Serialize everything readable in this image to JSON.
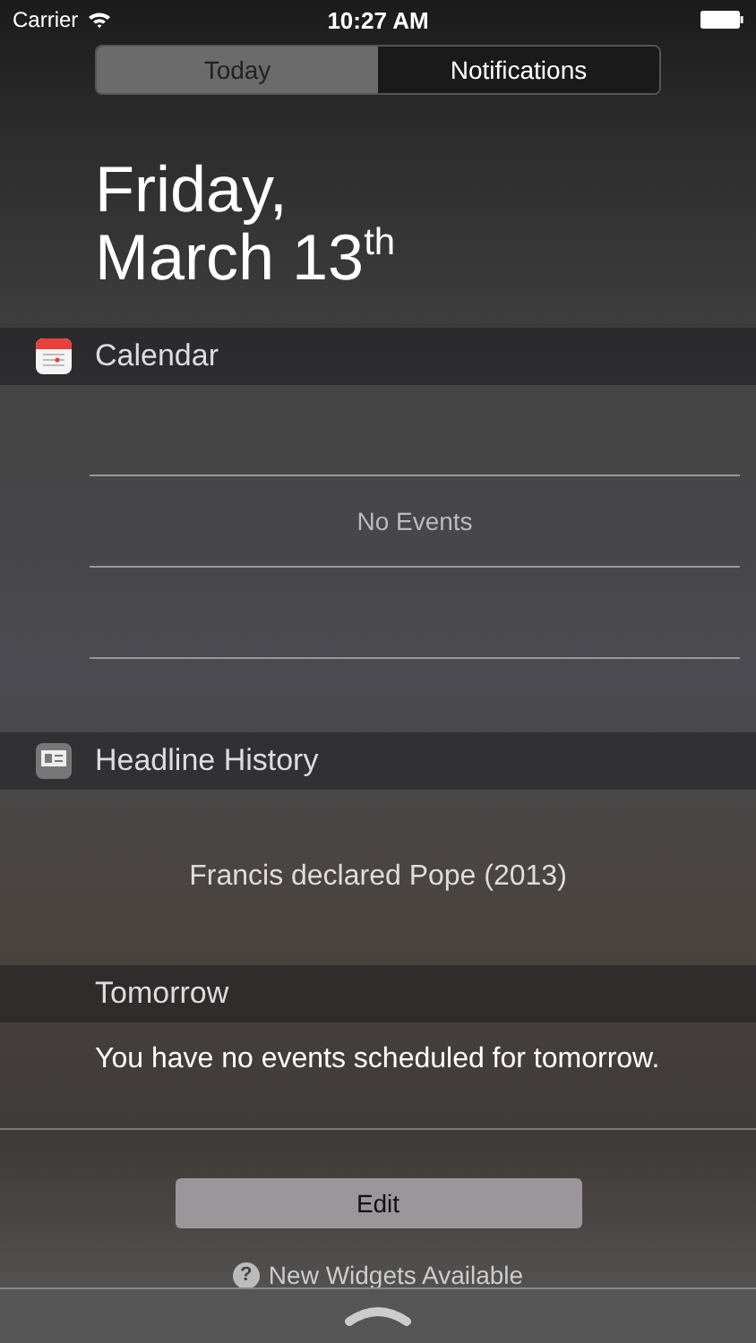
{
  "status_bar": {
    "carrier": "Carrier",
    "time": "10:27 AM"
  },
  "tabs": [
    {
      "label": "Today",
      "selected": true
    },
    {
      "label": "Notifications",
      "selected": false
    }
  ],
  "date": {
    "weekday": "Friday,",
    "day": "March 13$^{th}$"
  },
  "widgets": [
    {
      "kind": "calendar",
      "title": "Calendar",
      "message": "No Events"
    },
    {
      "kind": "headline",
      "title": "Headline History",
      "message": "Francis declared Pope (2013)"
    },
    {
      "kind": "tomorrow",
      "title": "Tomorrow",
      "message": "You have no events scheduled for tomorrow."
    }
  ],
  "edit_button": "Edit",
  "new_widgets": {
    "icon": "?",
    "label": "New Widgets Available"
  }
}
